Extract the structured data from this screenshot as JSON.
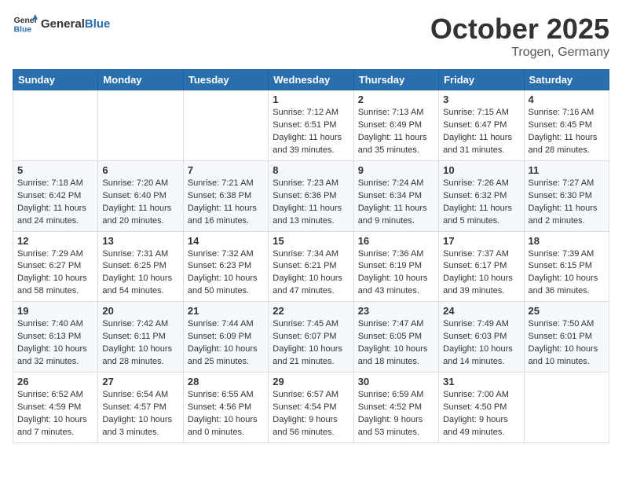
{
  "header": {
    "logo_general": "General",
    "logo_blue": "Blue",
    "month": "October 2025",
    "location": "Trogen, Germany"
  },
  "weekdays": [
    "Sunday",
    "Monday",
    "Tuesday",
    "Wednesday",
    "Thursday",
    "Friday",
    "Saturday"
  ],
  "weeks": [
    [
      {
        "day": "",
        "info": ""
      },
      {
        "day": "",
        "info": ""
      },
      {
        "day": "",
        "info": ""
      },
      {
        "day": "1",
        "info": "Sunrise: 7:12 AM\nSunset: 6:51 PM\nDaylight: 11 hours and 39 minutes."
      },
      {
        "day": "2",
        "info": "Sunrise: 7:13 AM\nSunset: 6:49 PM\nDaylight: 11 hours and 35 minutes."
      },
      {
        "day": "3",
        "info": "Sunrise: 7:15 AM\nSunset: 6:47 PM\nDaylight: 11 hours and 31 minutes."
      },
      {
        "day": "4",
        "info": "Sunrise: 7:16 AM\nSunset: 6:45 PM\nDaylight: 11 hours and 28 minutes."
      }
    ],
    [
      {
        "day": "5",
        "info": "Sunrise: 7:18 AM\nSunset: 6:42 PM\nDaylight: 11 hours and 24 minutes."
      },
      {
        "day": "6",
        "info": "Sunrise: 7:20 AM\nSunset: 6:40 PM\nDaylight: 11 hours and 20 minutes."
      },
      {
        "day": "7",
        "info": "Sunrise: 7:21 AM\nSunset: 6:38 PM\nDaylight: 11 hours and 16 minutes."
      },
      {
        "day": "8",
        "info": "Sunrise: 7:23 AM\nSunset: 6:36 PM\nDaylight: 11 hours and 13 minutes."
      },
      {
        "day": "9",
        "info": "Sunrise: 7:24 AM\nSunset: 6:34 PM\nDaylight: 11 hours and 9 minutes."
      },
      {
        "day": "10",
        "info": "Sunrise: 7:26 AM\nSunset: 6:32 PM\nDaylight: 11 hours and 5 minutes."
      },
      {
        "day": "11",
        "info": "Sunrise: 7:27 AM\nSunset: 6:30 PM\nDaylight: 11 hours and 2 minutes."
      }
    ],
    [
      {
        "day": "12",
        "info": "Sunrise: 7:29 AM\nSunset: 6:27 PM\nDaylight: 10 hours and 58 minutes."
      },
      {
        "day": "13",
        "info": "Sunrise: 7:31 AM\nSunset: 6:25 PM\nDaylight: 10 hours and 54 minutes."
      },
      {
        "day": "14",
        "info": "Sunrise: 7:32 AM\nSunset: 6:23 PM\nDaylight: 10 hours and 50 minutes."
      },
      {
        "day": "15",
        "info": "Sunrise: 7:34 AM\nSunset: 6:21 PM\nDaylight: 10 hours and 47 minutes."
      },
      {
        "day": "16",
        "info": "Sunrise: 7:36 AM\nSunset: 6:19 PM\nDaylight: 10 hours and 43 minutes."
      },
      {
        "day": "17",
        "info": "Sunrise: 7:37 AM\nSunset: 6:17 PM\nDaylight: 10 hours and 39 minutes."
      },
      {
        "day": "18",
        "info": "Sunrise: 7:39 AM\nSunset: 6:15 PM\nDaylight: 10 hours and 36 minutes."
      }
    ],
    [
      {
        "day": "19",
        "info": "Sunrise: 7:40 AM\nSunset: 6:13 PM\nDaylight: 10 hours and 32 minutes."
      },
      {
        "day": "20",
        "info": "Sunrise: 7:42 AM\nSunset: 6:11 PM\nDaylight: 10 hours and 28 minutes."
      },
      {
        "day": "21",
        "info": "Sunrise: 7:44 AM\nSunset: 6:09 PM\nDaylight: 10 hours and 25 minutes."
      },
      {
        "day": "22",
        "info": "Sunrise: 7:45 AM\nSunset: 6:07 PM\nDaylight: 10 hours and 21 minutes."
      },
      {
        "day": "23",
        "info": "Sunrise: 7:47 AM\nSunset: 6:05 PM\nDaylight: 10 hours and 18 minutes."
      },
      {
        "day": "24",
        "info": "Sunrise: 7:49 AM\nSunset: 6:03 PM\nDaylight: 10 hours and 14 minutes."
      },
      {
        "day": "25",
        "info": "Sunrise: 7:50 AM\nSunset: 6:01 PM\nDaylight: 10 hours and 10 minutes."
      }
    ],
    [
      {
        "day": "26",
        "info": "Sunrise: 6:52 AM\nSunset: 4:59 PM\nDaylight: 10 hours and 7 minutes."
      },
      {
        "day": "27",
        "info": "Sunrise: 6:54 AM\nSunset: 4:57 PM\nDaylight: 10 hours and 3 minutes."
      },
      {
        "day": "28",
        "info": "Sunrise: 6:55 AM\nSunset: 4:56 PM\nDaylight: 10 hours and 0 minutes."
      },
      {
        "day": "29",
        "info": "Sunrise: 6:57 AM\nSunset: 4:54 PM\nDaylight: 9 hours and 56 minutes."
      },
      {
        "day": "30",
        "info": "Sunrise: 6:59 AM\nSunset: 4:52 PM\nDaylight: 9 hours and 53 minutes."
      },
      {
        "day": "31",
        "info": "Sunrise: 7:00 AM\nSunset: 4:50 PM\nDaylight: 9 hours and 49 minutes."
      },
      {
        "day": "",
        "info": ""
      }
    ]
  ]
}
